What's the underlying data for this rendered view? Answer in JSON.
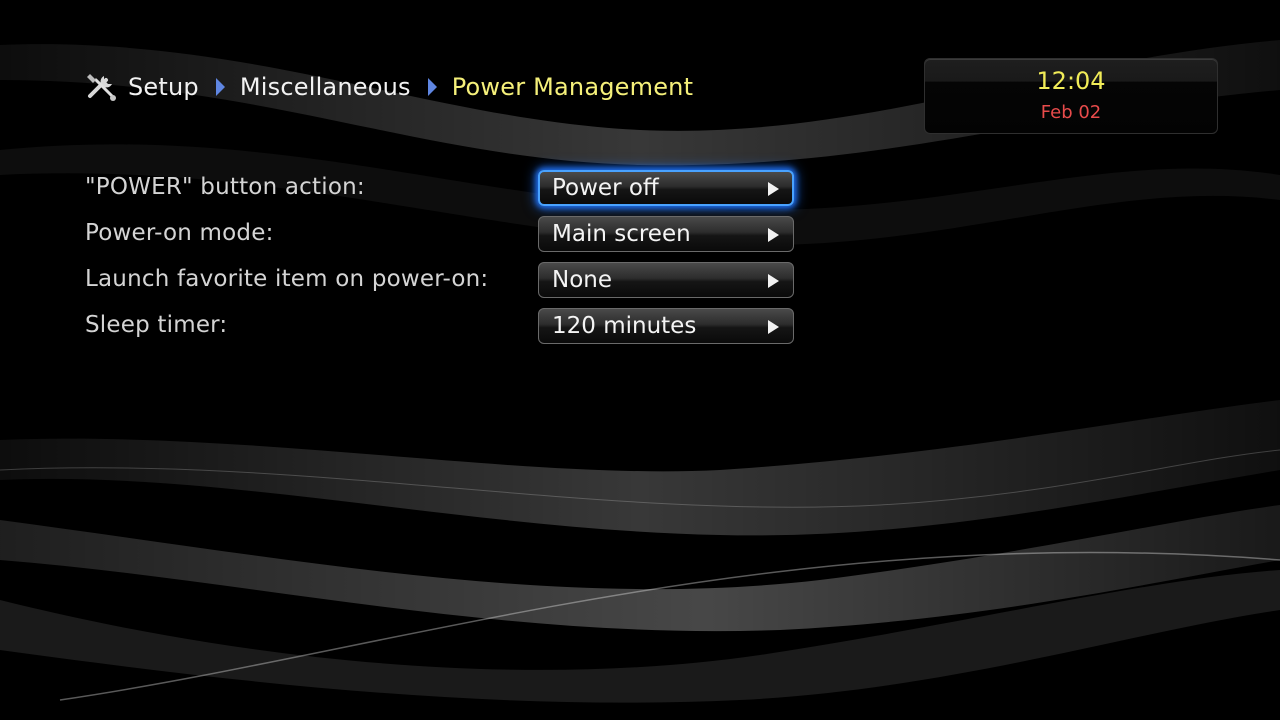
{
  "breadcrumb": {
    "icon": "tools-icon",
    "items": [
      "Setup",
      "Miscellaneous"
    ],
    "current": "Power Management",
    "separator_color": "#5f86e2",
    "current_color": "#f5f07a"
  },
  "clock": {
    "time": "12:04",
    "date": "Feb 02",
    "time_color": "#f1ec58",
    "date_color": "#e84b4b"
  },
  "settings": [
    {
      "label": "\"POWER\" button action:",
      "value": "Power off",
      "selected": true
    },
    {
      "label": "Power-on mode:",
      "value": "Main screen",
      "selected": false
    },
    {
      "label": "Launch favorite item on power-on:",
      "value": "None",
      "selected": false
    },
    {
      "label": "Sleep timer:",
      "value": "120 minutes",
      "selected": false
    }
  ],
  "colors": {
    "background": "#000000",
    "focus_glow": "#49a2ff"
  }
}
